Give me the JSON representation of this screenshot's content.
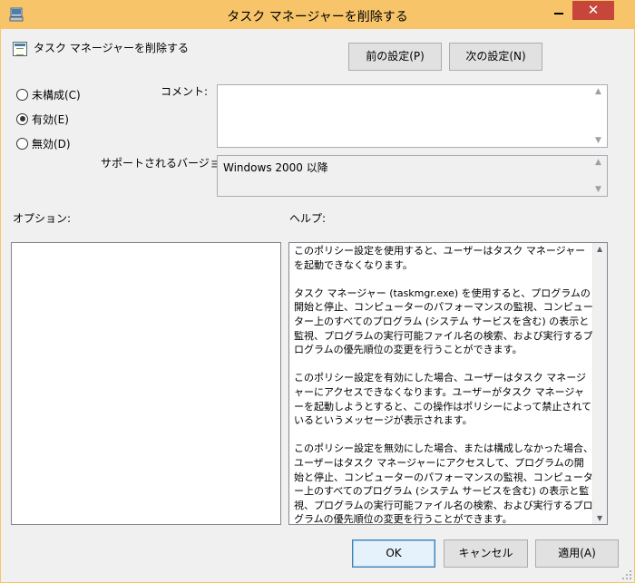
{
  "window": {
    "title": "タスク マネージャーを削除する"
  },
  "titlebar": {
    "min_label": "",
    "close_label": "✕"
  },
  "policy": {
    "name": "タスク マネージャーを削除する"
  },
  "nav": {
    "prev_label": "前の設定(P)",
    "next_label": "次の設定(N)"
  },
  "state": {
    "options": [
      {
        "label": "未構成(C)",
        "checked": false
      },
      {
        "label": "有効(E)",
        "checked": true
      },
      {
        "label": "無効(D)",
        "checked": false
      }
    ]
  },
  "comment": {
    "label": "コメント:",
    "value": ""
  },
  "supported": {
    "label": "サポートされるバージョン:",
    "value": "Windows 2000 以降"
  },
  "options_section": {
    "label": "オプション:"
  },
  "help_section": {
    "label": "ヘルプ:",
    "paragraphs": [
      "このポリシー設定を使用すると、ユーザーはタスク マネージャーを起動できなくなります。",
      "タスク マネージャー (taskmgr.exe) を使用すると、プログラムの開始と停止、コンピューターのパフォーマンスの監視、コンピューター上のすべてのプログラム (システム サービスを含む) の表示と監視、プログラムの実行可能ファイル名の検索、および実行するプログラムの優先順位の変更を行うことができます。",
      "このポリシー設定を有効にした場合、ユーザーはタスク マネージャーにアクセスできなくなります。ユーザーがタスク マネージャーを起動しようとすると、この操作はポリシーによって禁止されているというメッセージが表示されます。",
      "このポリシー設定を無効にした場合、または構成しなかった場合、ユーザーはタスク マネージャーにアクセスして、プログラムの開始と停止、コンピューターのパフォーマンスの監視、コンピューター上のすべてのプログラム (システム サービスを含む) の表示と監視、プログラムの実行可能ファイル名の検索、および実行するプログラムの優先順位の変更を行うことができます。"
    ]
  },
  "footer": {
    "ok_label": "OK",
    "cancel_label": "キャンセル",
    "apply_label": "適用(A)"
  },
  "colors": {
    "titlebar": "#f7c46a",
    "close": "#c7463c"
  }
}
